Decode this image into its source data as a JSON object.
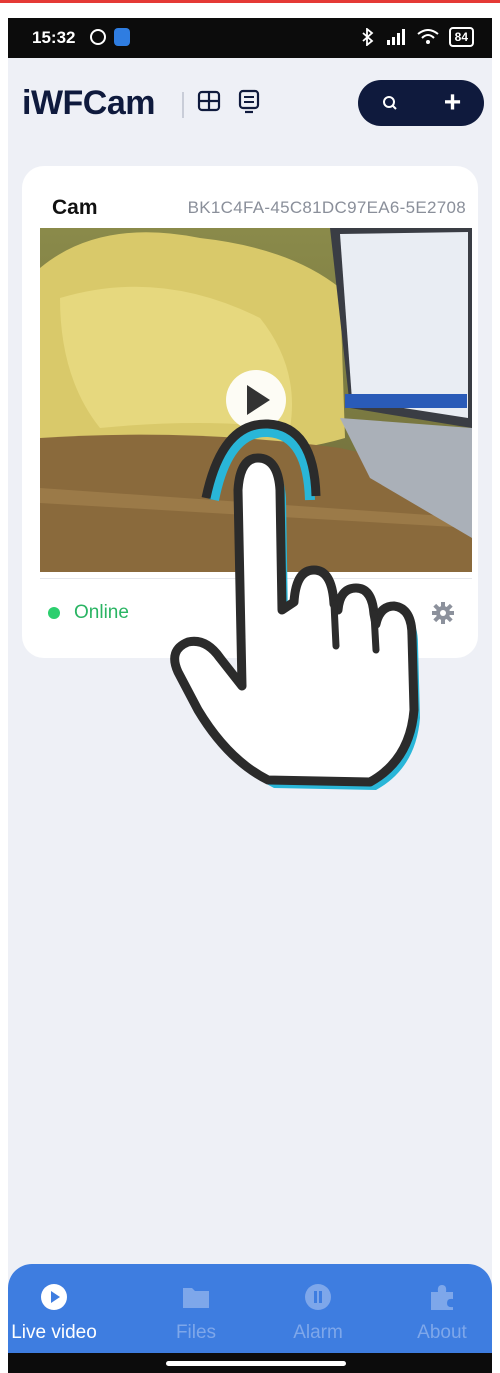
{
  "status_bar": {
    "time": "15:32",
    "battery": "84",
    "right_icons": [
      "bluetooth-icon",
      "signal-icon",
      "wifi-icon",
      "battery-icon"
    ]
  },
  "header": {
    "title": "iWFCam",
    "view_icons": [
      "grid-view-icon",
      "list-view-icon"
    ],
    "search_icon": "search-icon",
    "add_label": "+"
  },
  "device": {
    "name": "Cam",
    "id": "BK1C4FA-45C81DC97EA6-5E2708",
    "status": "Online",
    "status_color": "#2ccf6e"
  },
  "bottom_nav": [
    {
      "label": "Live video",
      "icon": "play-circle-icon",
      "active": true
    },
    {
      "label": "Files",
      "icon": "folder-icon",
      "active": false
    },
    {
      "label": "Alarm",
      "icon": "alarm-icon",
      "active": false
    },
    {
      "label": "About",
      "icon": "puzzle-icon",
      "active": false
    }
  ],
  "colors": {
    "accent": "#0f1a3d",
    "nav_bg": "#3e7de0",
    "page_bg": "#eef0f6"
  }
}
